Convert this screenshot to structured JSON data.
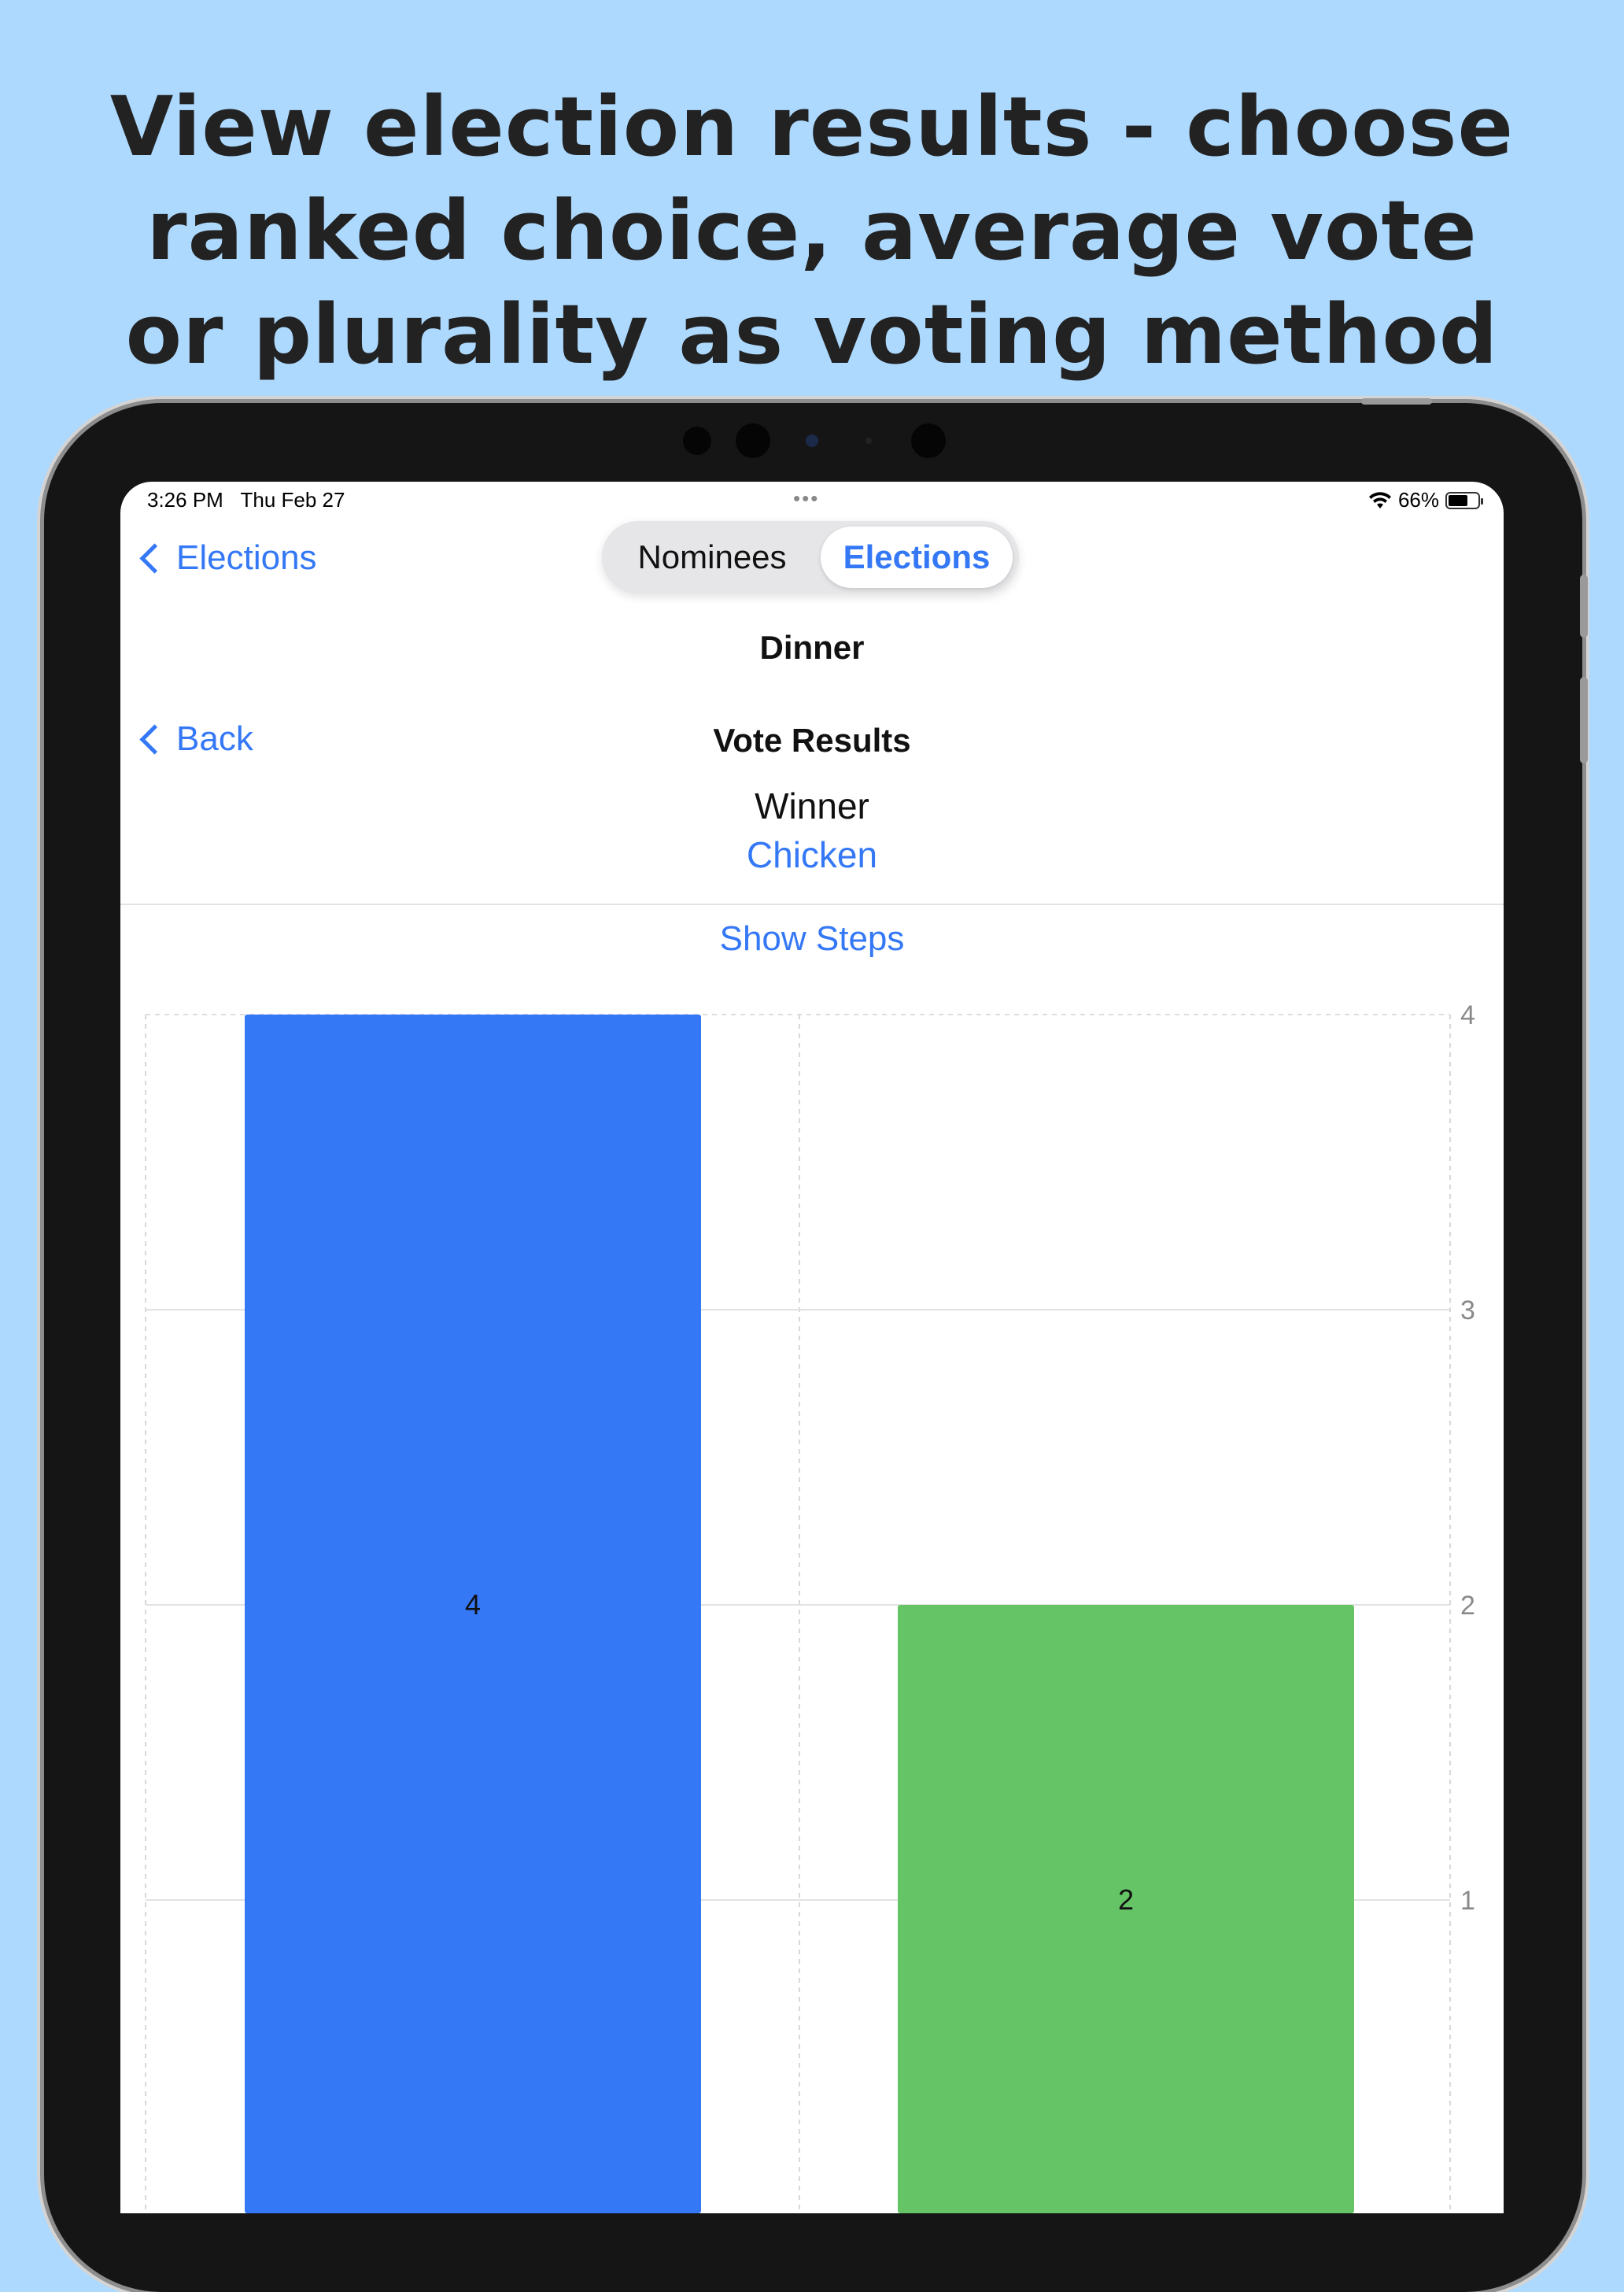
{
  "headline": {
    "line1": "View election results - choose",
    "line2": "ranked choice, average vote",
    "line3": "or plurality as voting method"
  },
  "status_bar": {
    "time": "3:26 PM",
    "date": "Thu Feb 27",
    "battery": "66%",
    "battery_level": 0.66,
    "dots": "•••"
  },
  "nav": {
    "back_elections": "Elections",
    "segments": [
      "Nominees",
      "Elections"
    ],
    "selected_segment": "Elections",
    "title": "Dinner"
  },
  "results": {
    "back": "Back",
    "title": "Vote Results",
    "winner_label": "Winner",
    "winner_value": "Chicken",
    "show_steps": "Show Steps"
  },
  "colors": {
    "accent": "#3478F6",
    "bar1": "#3478F6",
    "bar2": "#65C466",
    "background": "#ADD9FE"
  },
  "chart_data": {
    "type": "bar",
    "categories": [
      "",
      ""
    ],
    "values": [
      4,
      2
    ],
    "data_labels": [
      "4",
      "2"
    ],
    "yticks": [
      "4",
      "3",
      "2",
      "1"
    ],
    "ylim": [
      0,
      4
    ],
    "grid": true
  }
}
